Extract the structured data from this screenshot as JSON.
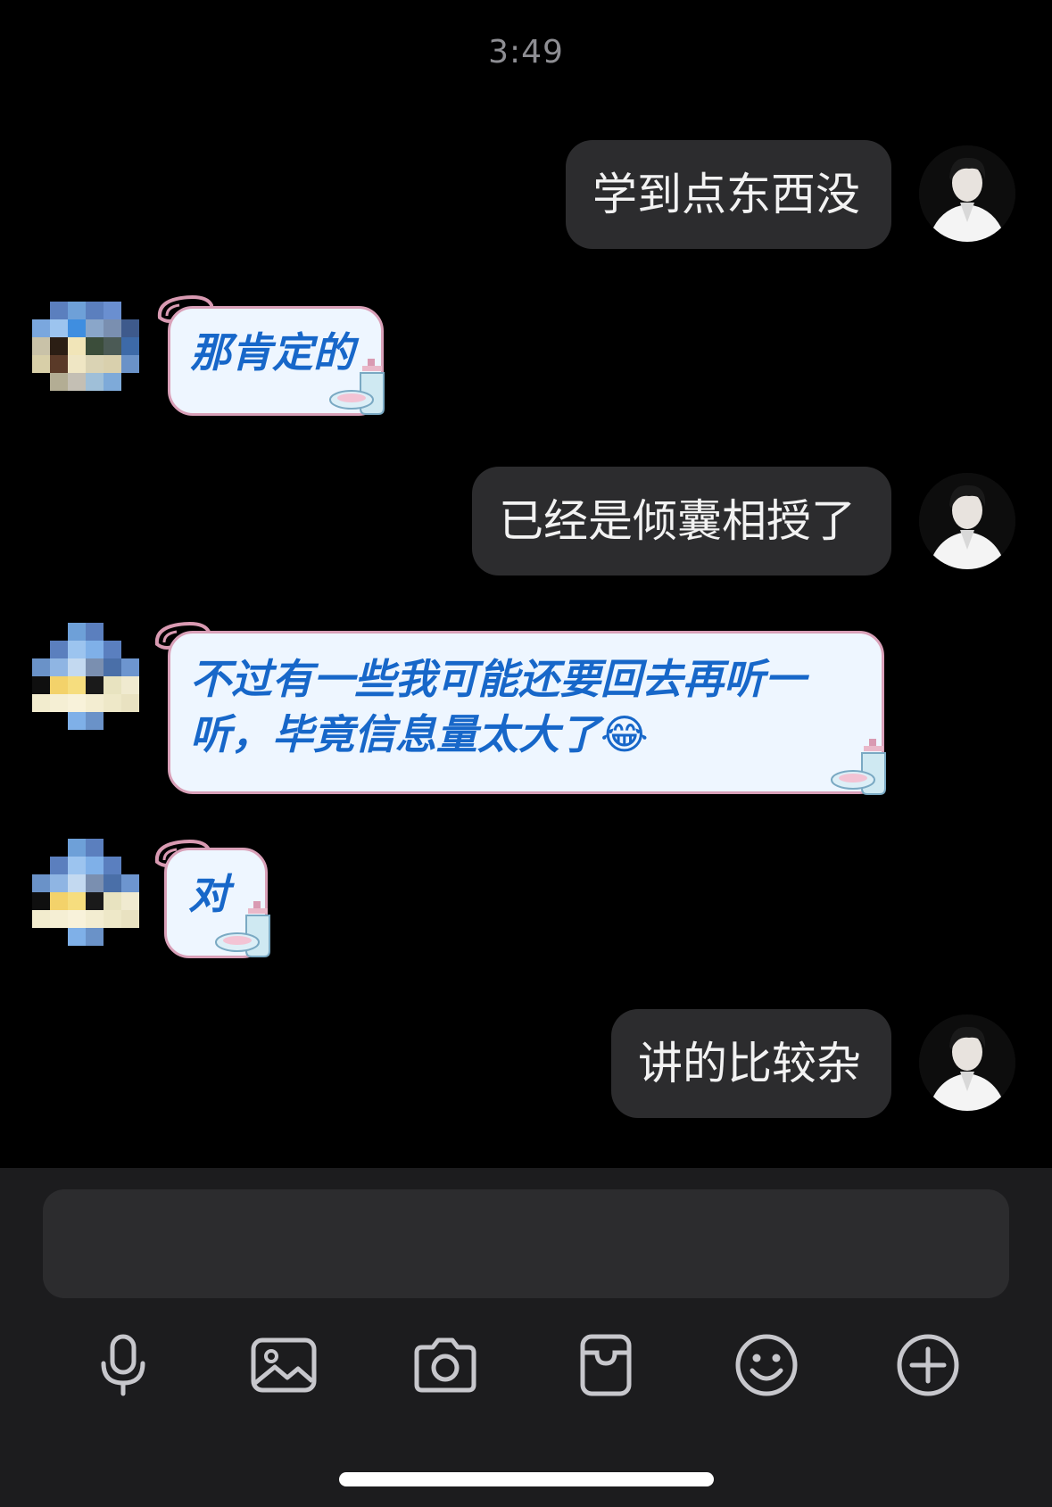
{
  "chat": {
    "time": "3:49",
    "messages": [
      {
        "from": "me",
        "text": "学到点东西没"
      },
      {
        "from": "other",
        "text": "那肯定的"
      },
      {
        "from": "me",
        "text": "已经是倾囊相授了"
      },
      {
        "from": "other",
        "text": "不过有一些我可能还要回去再听一听，毕竟信息量太大了"
      },
      {
        "from": "other",
        "text": "对"
      },
      {
        "from": "me",
        "text": "讲的比较杂"
      }
    ],
    "emoji": "😂"
  },
  "composer": {
    "input_value": "",
    "tools": [
      "microphone-icon",
      "image-icon",
      "camera-icon",
      "sticker-icon",
      "emoji-icon",
      "plus-icon"
    ]
  },
  "colors": {
    "background": "#000000",
    "outgoing_bubble": "#2c2c2e",
    "incoming_bubble": "#eef6ff",
    "incoming_text": "#1767c9",
    "composer_bar": "#1c1c1e"
  }
}
